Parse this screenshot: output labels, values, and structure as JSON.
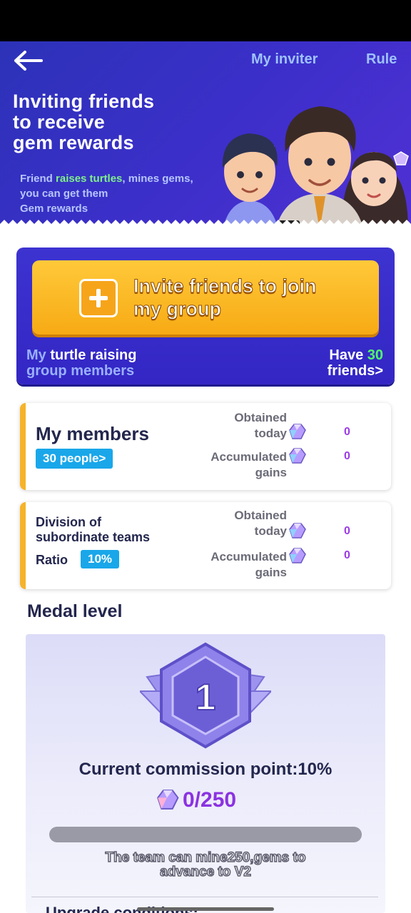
{
  "header": {
    "my_inviter": "My inviter",
    "rule": "Rule",
    "title_line1": "Inviting friends",
    "title_line2": "to receive",
    "title_line3": "gem rewards",
    "sub_pre": "Friend ",
    "sub_highlight": "raises turtles",
    "sub_post": ", mines gems,",
    "sub_line2": "you can get them",
    "sub_line3": "Gem rewards"
  },
  "invite": {
    "button_line1": "Invite friends to join",
    "button_line2": "my group",
    "members_my": "My",
    "members_rest": " turtle raising",
    "members_line2": "group members",
    "have": "Have ",
    "friends_count": "30",
    "friends_suffix": "friends>"
  },
  "my_members": {
    "title": "My members",
    "people_badge": "30 people>",
    "obtained_line1": "Obtained",
    "obtained_line2": "today",
    "obtained_value": "0",
    "accumulated_line1": "Accumulated",
    "accumulated_line2": "gains",
    "accumulated_value": "0"
  },
  "subordinate": {
    "title_line1": "Division of",
    "title_line2": "subordinate teams",
    "ratio_label": "Ratio",
    "ratio_value": "10%",
    "obtained_line1": "Obtained",
    "obtained_line2": "today",
    "obtained_value": "0",
    "accumulated_line1": "Accumulated",
    "accumulated_line2": "gains",
    "accumulated_value": "0"
  },
  "medal": {
    "heading": "Medal level",
    "level": "1",
    "commission": "Current commission point:10%",
    "progress_text": "0/250",
    "progress_fraction": 0,
    "advance_line1": "The team can mine250,gems to",
    "advance_line2": "advance to V2",
    "upgrade_heading": "Upgrade conditions:"
  },
  "icons": {
    "back": "arrow-left-icon",
    "gem": "gem-icon",
    "plus": "plus-icon"
  },
  "colors": {
    "header_bg": "#3b2fc9",
    "accent_orange": "#f7aa14",
    "badge_blue": "#19a7ea",
    "value_purple": "#9c3be6",
    "highlight_green": "#52ff6a"
  }
}
